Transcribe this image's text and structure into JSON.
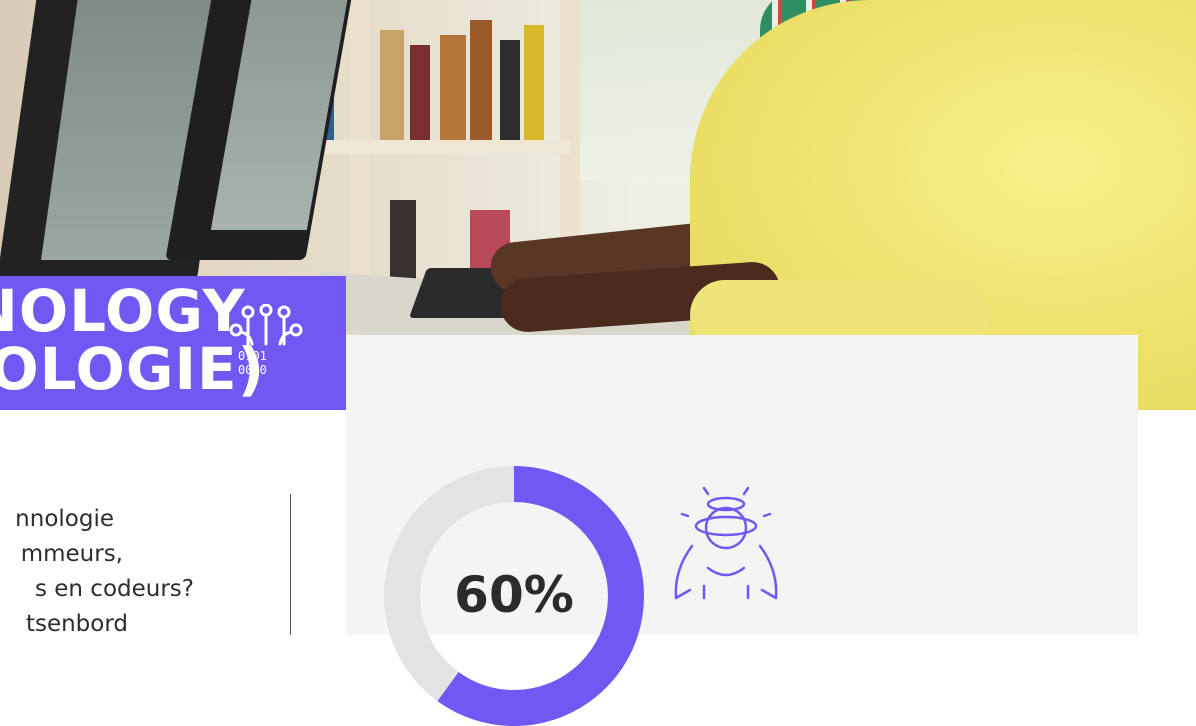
{
  "banner": {
    "title_line1": "TECHNOLOGY",
    "title_line2": "(TECHNOLOGIE)"
  },
  "question": {
    "lines": [
      "nnologie",
      "mmeurs,",
      "s en codeurs?",
      "tsenbord"
    ]
  },
  "stat": {
    "value_text": "60%",
    "percent": 0.6
  },
  "colors": {
    "accent": "#7357f2",
    "panel": "#f4f4f4",
    "ring_track": "#e3e3e3",
    "text": "#2b2b2b"
  },
  "icons": {
    "title_icon": "circuit-binary-icon",
    "stat_icon": "dizzy-person-icon"
  }
}
